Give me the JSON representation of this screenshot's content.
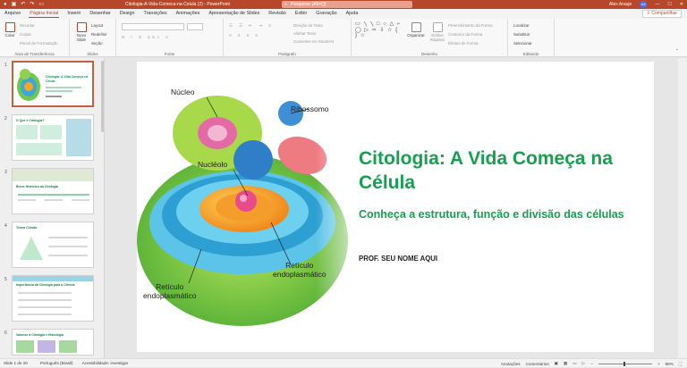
{
  "titlebar": {
    "doc_title": "Citologia-A-Vida-Comeca-na-Celula (2) - PowerPoint",
    "search_placeholder": "Pesquisar (Alt+Q)",
    "user_name": "Alex Araujo",
    "user_initials": "AA",
    "minimize": "—",
    "maximize": "☐",
    "close": "✕"
  },
  "menu": {
    "tabs": [
      "Arquivo",
      "Página Inicial",
      "Inserir",
      "Desenhar",
      "Design",
      "Transições",
      "Animações",
      "Apresentação de Slides",
      "Revisão",
      "Exibir",
      "Gravação",
      "Ajuda"
    ],
    "share": "Compartilhar"
  },
  "ribbon": {
    "clipboard": {
      "paste": "Colar",
      "cut": "Recortar",
      "copy": "Copiar",
      "format_painter": "Pincel de Formatação",
      "label": "Área de Transferência"
    },
    "slides": {
      "new_slide": "Novo Slide",
      "layout": "Layout",
      "reset": "Redefinir",
      "section": "Seção",
      "label": "Slides"
    },
    "font": {
      "label": "Fonte"
    },
    "paragraph": {
      "text_direction": "Direção do Texto",
      "align_text": "Alinhar Texto",
      "smartart": "Converter em SmartArt",
      "label": "Parágrafo"
    },
    "drawing": {
      "shapes_glyphs": "▭ ╲ ╲ □ ○ △ ⌐ ◯ ▷ ⇨ ⇩ ☆ { } ☆",
      "arrange": "Organizar",
      "quick_styles": "Estilos Rápidos",
      "fill": "Preenchimento da Forma",
      "outline": "Contorno da Forma",
      "effects": "Efeitos de Forma",
      "label": "Desenho"
    },
    "editing": {
      "find": "Localizar",
      "replace": "Substituir",
      "select": "Selecionar",
      "label": "Editando"
    }
  },
  "thumbnails": [
    {
      "num": "1",
      "title": "Citologia: A Vida Começa na Célula"
    },
    {
      "num": "2",
      "title": "O Que é Citologia?"
    },
    {
      "num": "3",
      "title": "Breve Histórico da Citologia"
    },
    {
      "num": "4",
      "title": "Teoria Celular"
    },
    {
      "num": "5",
      "title": "Importância da Citologia para a Ciência"
    },
    {
      "num": "6",
      "title": "Valorize a Citologia e Histologia"
    }
  ],
  "slide": {
    "labels": {
      "nucleo": "Núcleo",
      "ribossomo": "Ribossomo",
      "nucleolo": "Nucléolo",
      "reticulo_left": "Retículo\nendoplasmático",
      "reticulo_right": "Retículo\nendoplasmático"
    },
    "title": "Citologia: A Vida Começa na Célula",
    "subtitle": "Conheça a estrutura, função e divisão das células",
    "author": "PROF. SEU NOME AQUI"
  },
  "status": {
    "slide_count": "Slide 1 de 20",
    "language": "Português (Brasil)",
    "accessibility": "Acessibilidade: investigar",
    "notes": "Anotações",
    "comments": "Comentários",
    "zoom": "96%"
  },
  "colors": {
    "accent": "#b7472a",
    "title_green": "#17a050"
  }
}
